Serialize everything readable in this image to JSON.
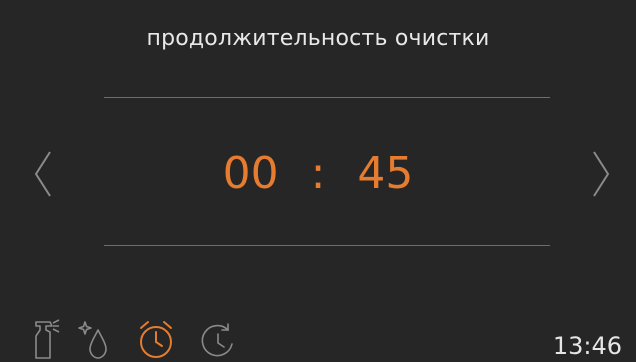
{
  "screen": {
    "title": "продолжительность очистки"
  },
  "duration": {
    "hours": "00",
    "separator": ":",
    "minutes": "45"
  },
  "navigation": {
    "prev_icon": "chevron-left-icon",
    "next_icon": "chevron-right-icon"
  },
  "bottom_bar": {
    "icons": [
      {
        "name": "spray-bottle-icon",
        "active": false
      },
      {
        "name": "water-drop-sparkle-icon",
        "active": false
      },
      {
        "name": "alarm-clock-icon",
        "active": true
      },
      {
        "name": "clock-refresh-icon",
        "active": false
      }
    ],
    "time": "13:46"
  },
  "colors": {
    "background": "#262626",
    "accent": "#e57c2f",
    "icon_inactive": "#8a8a8a",
    "text": "#e6e6e6",
    "divider": "#6d6d6d"
  }
}
